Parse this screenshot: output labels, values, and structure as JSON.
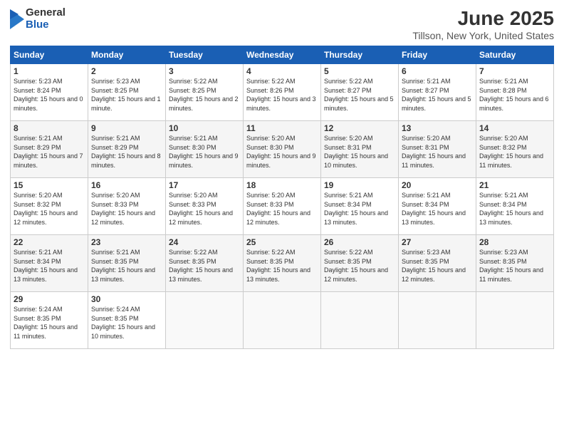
{
  "logo": {
    "general": "General",
    "blue": "Blue"
  },
  "title": "June 2025",
  "subtitle": "Tillson, New York, United States",
  "days_of_week": [
    "Sunday",
    "Monday",
    "Tuesday",
    "Wednesday",
    "Thursday",
    "Friday",
    "Saturday"
  ],
  "weeks": [
    [
      {
        "day": "1",
        "sunrise": "5:23 AM",
        "sunset": "8:24 PM",
        "daylight": "15 hours and 0 minutes."
      },
      {
        "day": "2",
        "sunrise": "5:23 AM",
        "sunset": "8:25 PM",
        "daylight": "15 hours and 1 minute."
      },
      {
        "day": "3",
        "sunrise": "5:22 AM",
        "sunset": "8:25 PM",
        "daylight": "15 hours and 2 minutes."
      },
      {
        "day": "4",
        "sunrise": "5:22 AM",
        "sunset": "8:26 PM",
        "daylight": "15 hours and 3 minutes."
      },
      {
        "day": "5",
        "sunrise": "5:22 AM",
        "sunset": "8:27 PM",
        "daylight": "15 hours and 5 minutes."
      },
      {
        "day": "6",
        "sunrise": "5:21 AM",
        "sunset": "8:27 PM",
        "daylight": "15 hours and 5 minutes."
      },
      {
        "day": "7",
        "sunrise": "5:21 AM",
        "sunset": "8:28 PM",
        "daylight": "15 hours and 6 minutes."
      }
    ],
    [
      {
        "day": "8",
        "sunrise": "5:21 AM",
        "sunset": "8:29 PM",
        "daylight": "15 hours and 7 minutes."
      },
      {
        "day": "9",
        "sunrise": "5:21 AM",
        "sunset": "8:29 PM",
        "daylight": "15 hours and 8 minutes."
      },
      {
        "day": "10",
        "sunrise": "5:21 AM",
        "sunset": "8:30 PM",
        "daylight": "15 hours and 9 minutes."
      },
      {
        "day": "11",
        "sunrise": "5:20 AM",
        "sunset": "8:30 PM",
        "daylight": "15 hours and 9 minutes."
      },
      {
        "day": "12",
        "sunrise": "5:20 AM",
        "sunset": "8:31 PM",
        "daylight": "15 hours and 10 minutes."
      },
      {
        "day": "13",
        "sunrise": "5:20 AM",
        "sunset": "8:31 PM",
        "daylight": "15 hours and 11 minutes."
      },
      {
        "day": "14",
        "sunrise": "5:20 AM",
        "sunset": "8:32 PM",
        "daylight": "15 hours and 11 minutes."
      }
    ],
    [
      {
        "day": "15",
        "sunrise": "5:20 AM",
        "sunset": "8:32 PM",
        "daylight": "15 hours and 12 minutes."
      },
      {
        "day": "16",
        "sunrise": "5:20 AM",
        "sunset": "8:33 PM",
        "daylight": "15 hours and 12 minutes."
      },
      {
        "day": "17",
        "sunrise": "5:20 AM",
        "sunset": "8:33 PM",
        "daylight": "15 hours and 12 minutes."
      },
      {
        "day": "18",
        "sunrise": "5:20 AM",
        "sunset": "8:33 PM",
        "daylight": "15 hours and 12 minutes."
      },
      {
        "day": "19",
        "sunrise": "5:21 AM",
        "sunset": "8:34 PM",
        "daylight": "15 hours and 13 minutes."
      },
      {
        "day": "20",
        "sunrise": "5:21 AM",
        "sunset": "8:34 PM",
        "daylight": "15 hours and 13 minutes."
      },
      {
        "day": "21",
        "sunrise": "5:21 AM",
        "sunset": "8:34 PM",
        "daylight": "15 hours and 13 minutes."
      }
    ],
    [
      {
        "day": "22",
        "sunrise": "5:21 AM",
        "sunset": "8:34 PM",
        "daylight": "15 hours and 13 minutes."
      },
      {
        "day": "23",
        "sunrise": "5:21 AM",
        "sunset": "8:35 PM",
        "daylight": "15 hours and 13 minutes."
      },
      {
        "day": "24",
        "sunrise": "5:22 AM",
        "sunset": "8:35 PM",
        "daylight": "15 hours and 13 minutes."
      },
      {
        "day": "25",
        "sunrise": "5:22 AM",
        "sunset": "8:35 PM",
        "daylight": "15 hours and 13 minutes."
      },
      {
        "day": "26",
        "sunrise": "5:22 AM",
        "sunset": "8:35 PM",
        "daylight": "15 hours and 12 minutes."
      },
      {
        "day": "27",
        "sunrise": "5:23 AM",
        "sunset": "8:35 PM",
        "daylight": "15 hours and 12 minutes."
      },
      {
        "day": "28",
        "sunrise": "5:23 AM",
        "sunset": "8:35 PM",
        "daylight": "15 hours and 11 minutes."
      }
    ],
    [
      {
        "day": "29",
        "sunrise": "5:24 AM",
        "sunset": "8:35 PM",
        "daylight": "15 hours and 11 minutes."
      },
      {
        "day": "30",
        "sunrise": "5:24 AM",
        "sunset": "8:35 PM",
        "daylight": "15 hours and 10 minutes."
      },
      null,
      null,
      null,
      null,
      null
    ]
  ]
}
